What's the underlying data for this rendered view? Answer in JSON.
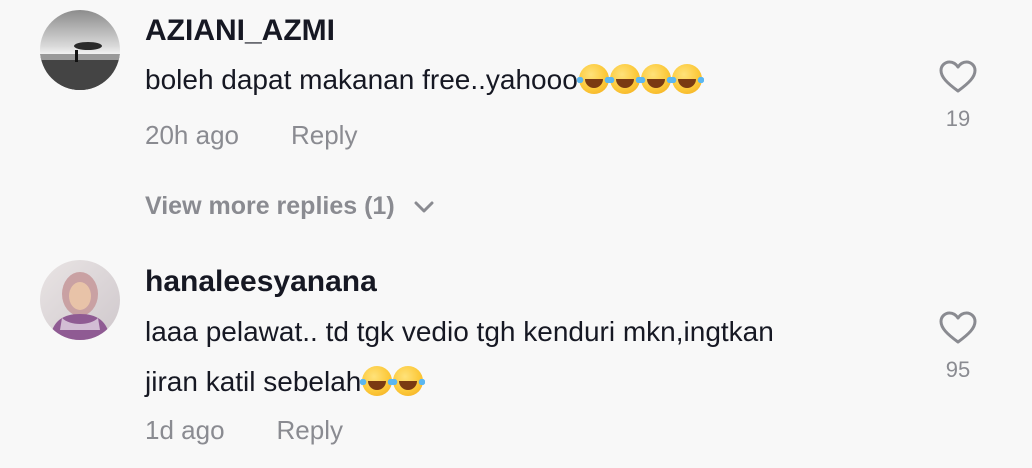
{
  "comments": [
    {
      "username": "AZIANI_AZMI",
      "text": "boleh dapat makanan free..yahooo",
      "emoji_count": 4,
      "time": "20h ago",
      "reply_label": "Reply",
      "likes": "19",
      "avatar_icon": "avatar-beach-photo"
    },
    {
      "username": "hanaleesyanana",
      "text_line1": "laaa pelawat.. td tgk vedio tgh kenduri mkn,ingtkan",
      "text_line2": "jiran katil sebelah",
      "emoji_count": 2,
      "time": "1d ago",
      "reply_label": "Reply",
      "likes": "95",
      "avatar_icon": "avatar-person-photo"
    }
  ],
  "view_more": {
    "label": "View more replies (1)",
    "icon": "chevron-down-icon"
  },
  "icons": {
    "like": "heart-outline-icon",
    "emoji": "face-with-tears-of-joy-emoji"
  },
  "colors": {
    "background": "#f8f8f8",
    "primary_text": "#161823",
    "secondary_text": "#8a8b91"
  }
}
